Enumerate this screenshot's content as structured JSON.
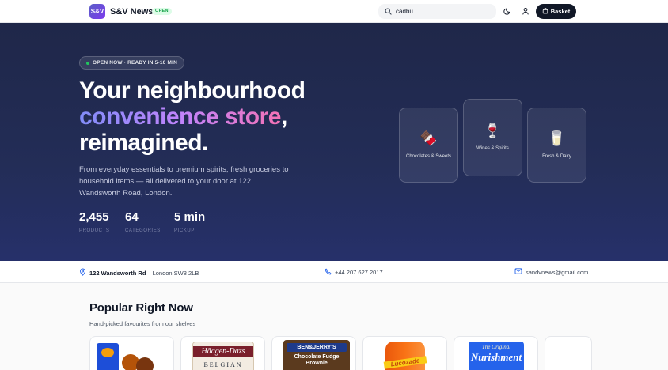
{
  "header": {
    "logo_text": "S&V",
    "brand": "S&V News",
    "open_badge": "OPEN",
    "search_value": "cadbu",
    "basket_label": "Basket"
  },
  "hero": {
    "status": "OPEN NOW · READY IN 5-10 MIN",
    "headline_line1": "Your neighbourhood",
    "headline_grad": "convenience store",
    "headline_comma": ",",
    "headline_line3": "reimagined.",
    "description": "From everyday essentials to premium spirits, fresh groceries to household items — all delivered to your door at 122 Wandsworth Road, London.",
    "stats": [
      {
        "value": "2,455",
        "label": "PRODUCTS"
      },
      {
        "value": "64",
        "label": "CATEGORIES"
      },
      {
        "value": "5 min",
        "label": "PICKUP"
      }
    ],
    "categories": [
      {
        "label": "Chocolates & Sweets",
        "emoji": "🍫"
      },
      {
        "label": "Wines & Spirits",
        "emoji": "🍷"
      },
      {
        "label": "Fresh & Dairy",
        "emoji": "🥛"
      }
    ]
  },
  "contact": {
    "address_bold": "122 Wandsworth Rd",
    "address_rest": ", London SW8 2LB",
    "phone": "+44 207 627 2017",
    "email": "sandvnews@gmail.com"
  },
  "popular": {
    "title": "Popular Right Now",
    "subtitle": "Hand-picked favourites from our shelves",
    "products": [
      {
        "label_line1": "",
        "label_line2": ""
      },
      {
        "label_line1": "Häagen-Dazs",
        "label_line2": "BELGIAN"
      },
      {
        "label_line1": "BEN&JERRY'S",
        "label_line2": "Chocolate Fudge Brownie"
      },
      {
        "label_line1": "Lucozade",
        "label_line2": ""
      },
      {
        "label_line1": "The Original",
        "label_line2": "Nurishment"
      },
      {
        "label_line1": "",
        "label_line2": ""
      }
    ]
  },
  "colors": {
    "hero_bg": "#232d57",
    "accent": "#818cf8",
    "open_green": "#16a34a",
    "basket_bg": "#111827"
  }
}
